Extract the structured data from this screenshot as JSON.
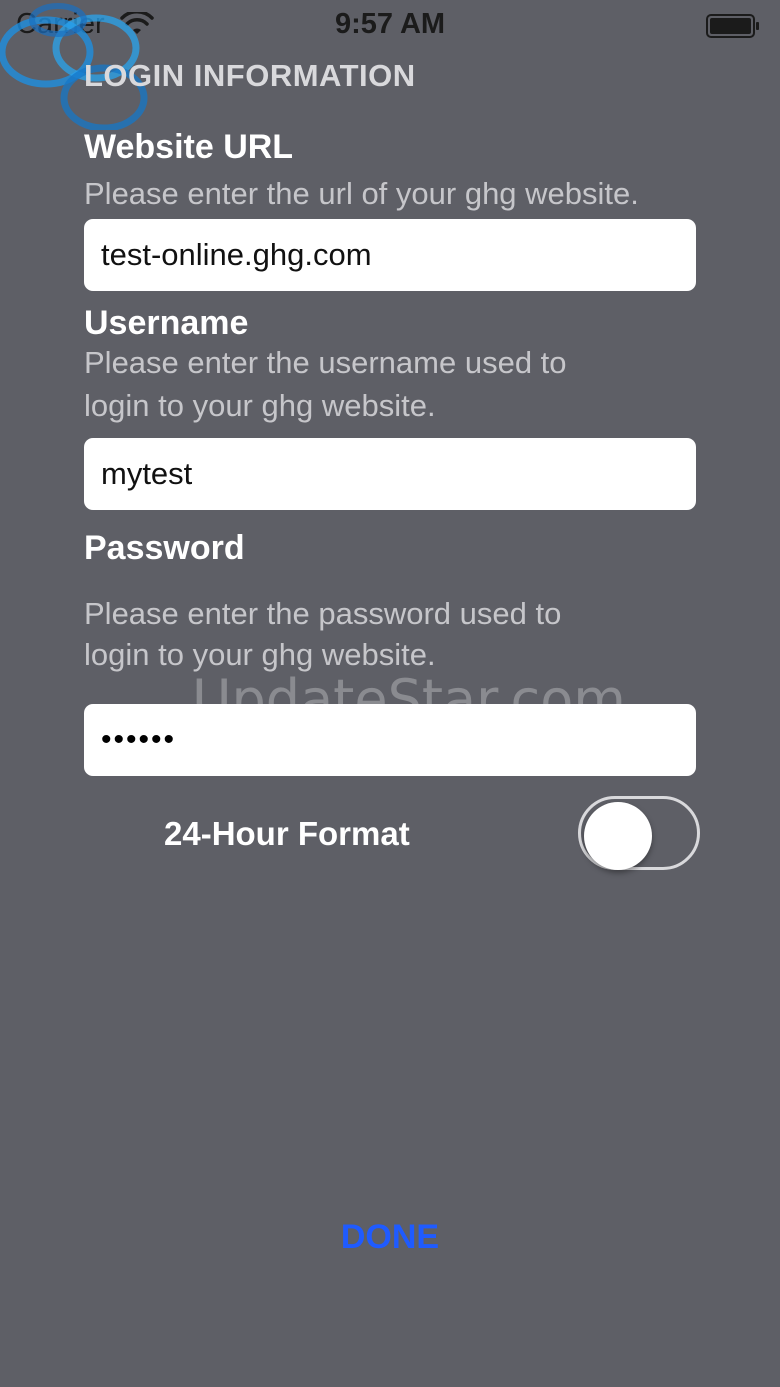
{
  "status_bar": {
    "carrier": "Carrier",
    "time": "9:57 AM",
    "wifi_icon": "wifi-icon",
    "battery_icon": "battery-icon"
  },
  "header": {
    "title": "LOGIN INFORMATION",
    "logo_icon": "ghg-logo"
  },
  "website": {
    "label": "Website URL",
    "helper": "Please enter the url of your ghg website.",
    "value": "test-online.ghg.com"
  },
  "username": {
    "label": "Username",
    "helper_line1": "Please enter the username used to",
    "helper_line2": "login to your ghg website.",
    "value": "mytest"
  },
  "password": {
    "label": "Password",
    "helper_line1": "Please enter the password used to",
    "helper_line2": "login to your ghg website.",
    "value": "••••••"
  },
  "time_format": {
    "label": "24-Hour Format",
    "enabled": false
  },
  "done_label": "DONE",
  "watermark": "UpdateStar.com",
  "colors": {
    "background": "#5e5f66",
    "accent": "#1f5bff",
    "logo": "#1e8fe0"
  }
}
